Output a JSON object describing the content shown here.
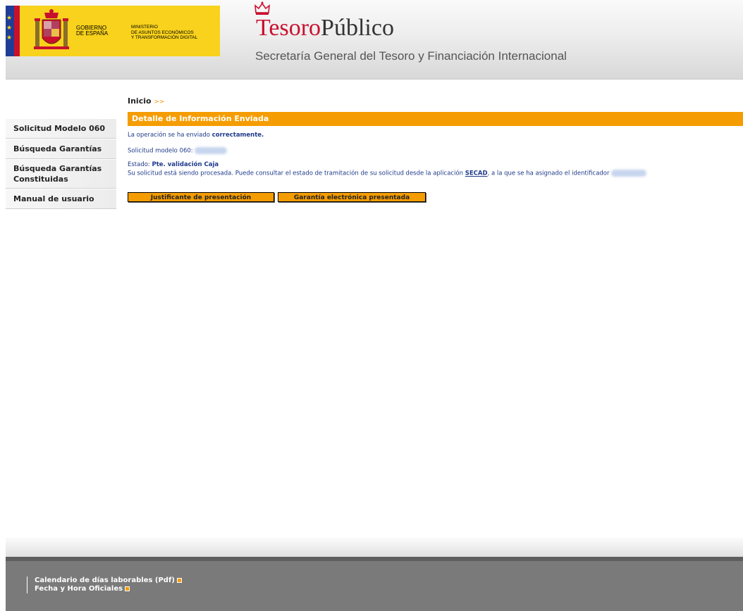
{
  "header": {
    "gov_line1": "GOBIERNO",
    "gov_line2": "DE ESPAÑA",
    "ministry_line1": "MINISTERIO",
    "ministry_line2": "DE ASUNTOS ECONÓMICOS",
    "ministry_line3": "Y TRANSFORMACIÓN DIGITAL",
    "logo_part1": "Tesoro",
    "logo_part2": "Público",
    "subtitle": "Secretaría General del Tesoro y Financiación Internacional"
  },
  "breadcrumb": {
    "home": "Inicio",
    "separator": ">>"
  },
  "sidebar": {
    "items": [
      {
        "label": "Solicitud Modelo 060"
      },
      {
        "label": "Búsqueda Garantías"
      },
      {
        "label": "Búsqueda Garantías Constituidas"
      },
      {
        "label": "Manual de usuario"
      }
    ]
  },
  "main": {
    "section_title": "Detalle de Información Enviada",
    "msg1_prefix": "La operación se ha enviado ",
    "msg1_bold": "correctamente.",
    "request_label": "Solicitud modelo 060:",
    "status_label": "Estado:",
    "status_value": "Pte. validación Caja",
    "processing_text": "Su solicitud está siendo procesada. Puede consultar el estado de tramitación de su solicitud desde la aplicación",
    "secad_link": "SECAD",
    "processing_suffix": ", a la que se ha asignado el identificador",
    "buttons": {
      "receipt": "Justificante de presentación",
      "guarantee": "Garantía electrónica presentada"
    }
  },
  "footer": {
    "links": [
      {
        "label": "Calendario de días laborables (Pdf)"
      },
      {
        "label": "Fecha y Hora Oficiales"
      }
    ]
  },
  "colors": {
    "accent_orange": "#f59d00",
    "text_blue": "#1f3a8a",
    "gov_yellow": "#f8d21c",
    "logo_red": "#c8102e",
    "footer_gray": "#7a7a7a"
  }
}
